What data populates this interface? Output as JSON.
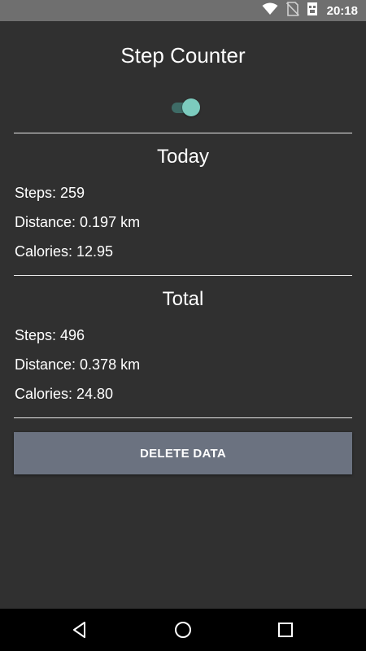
{
  "status_bar": {
    "time": "20:18",
    "icons": [
      "wifi-icon",
      "no-signal-icon",
      "sd-card-icon"
    ]
  },
  "app": {
    "title": "Step Counter",
    "tracking_toggle_on": true,
    "accent_color": "#7ccbbe"
  },
  "today": {
    "heading": "Today",
    "steps": "Steps: 259",
    "distance": "Distance: 0.197 km",
    "calories": "Calories: 12.95"
  },
  "total": {
    "heading": "Total",
    "steps": "Steps: 496",
    "distance": "Distance: 0.378 km",
    "calories": "Calories: 24.80"
  },
  "actions": {
    "delete_label": "DELETE DATA"
  },
  "nav_bar": {
    "icons": [
      "back-icon",
      "home-icon",
      "recents-icon"
    ]
  }
}
